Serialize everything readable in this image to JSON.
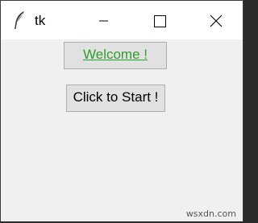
{
  "window": {
    "title": "tk",
    "icon": "feather-icon",
    "controls": [
      "minimize-icon",
      "maximize-icon",
      "close-icon"
    ]
  },
  "buttons": {
    "welcome_label": "Welcome !",
    "start_label": "Click to Start !"
  },
  "colors": {
    "welcome_text": "#2e9f2e",
    "client_background": "#f0f0f0",
    "button_background": "#e1e1e1"
  },
  "watermark": "wsxdn.com"
}
